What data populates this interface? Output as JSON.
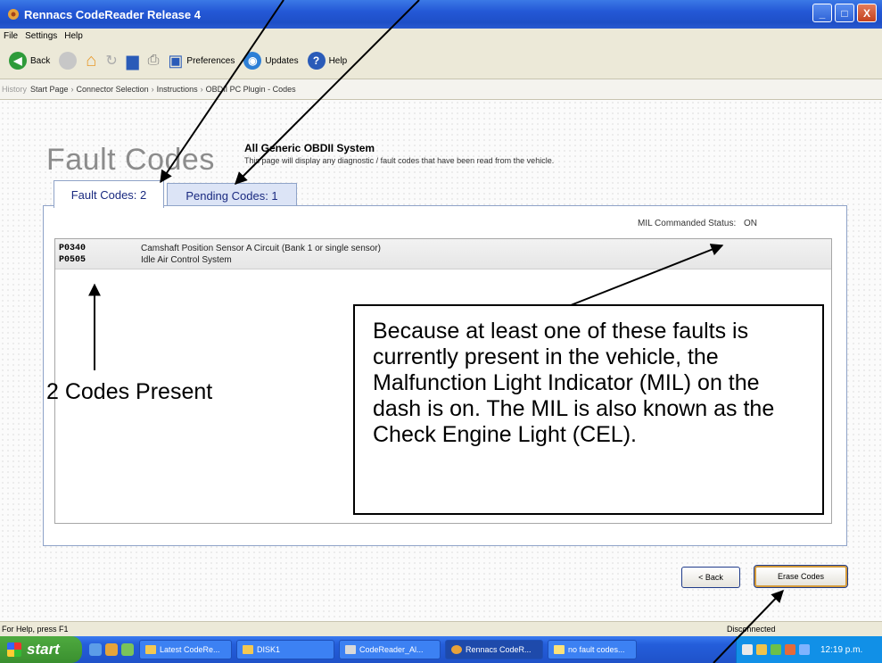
{
  "window": {
    "title": "Rennacs CodeReader Release 4",
    "buttons": [
      "_",
      "□",
      "X"
    ]
  },
  "menu": [
    "File",
    "Settings",
    "Help"
  ],
  "toolbar": {
    "back": "Back",
    "preferences": "Preferences",
    "updates": "Updates",
    "help": "Help"
  },
  "breadcrumb": {
    "history": "History",
    "items": [
      "Start Page",
      "Connector Selection",
      "Instructions",
      "OBDII PC Plugin - Codes"
    ]
  },
  "page": {
    "heading": "Fault Codes",
    "system_title": "All Generic OBDII System",
    "system_desc": "This page will display any diagnostic / fault codes that have been read from the vehicle.",
    "tabs": [
      {
        "label": "Fault Codes: 2",
        "active": true
      },
      {
        "label": "Pending Codes: 1",
        "active": false
      }
    ],
    "mil": {
      "label": "MIL Commanded Status:",
      "value": "ON"
    },
    "codes": [
      {
        "code": "P0340",
        "description": "Camshaft Position Sensor A Circuit (Bank 1 or single sensor)"
      },
      {
        "code": "P0505",
        "description": "Idle Air Control System"
      }
    ],
    "back_button": "< Back",
    "erase_button": "Erase Codes"
  },
  "statusbar": {
    "help": "For Help, press F1",
    "state": "Disconnected"
  },
  "taskbar": {
    "start": "start",
    "tasks": [
      {
        "label": "Latest CodeRe...",
        "active": false
      },
      {
        "label": "DISK1",
        "active": false
      },
      {
        "label": "CodeReader_Al...",
        "active": false
      },
      {
        "label": "Rennacs CodeR...",
        "active": true
      },
      {
        "label": "no fault codes...",
        "active": false
      }
    ],
    "clock": "12:19 p.m."
  },
  "annotations": {
    "callout": "Because at least one of these faults is currently present in the vehicle, the Malfunction Light Indicator (MIL) on the dash is on. The MIL is also known as the Check Engine Light (CEL).",
    "count_label": "2 Codes Present"
  }
}
